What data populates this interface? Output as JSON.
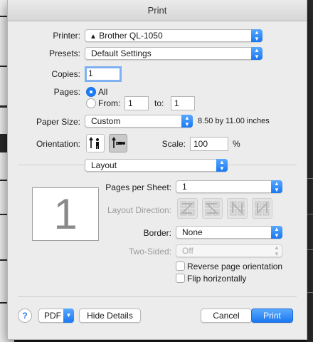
{
  "window": {
    "title": "Print"
  },
  "printer": {
    "label": "Printer:",
    "value": "Brother QL-1050",
    "warning_icon": "warning-triangle-icon"
  },
  "presets": {
    "label": "Presets:",
    "value": "Default Settings"
  },
  "copies": {
    "label": "Copies:",
    "value": "1"
  },
  "pages": {
    "label": "Pages:",
    "all_label": "All",
    "from_label": "From:",
    "from_value": "1",
    "to_label": "to:",
    "to_value": "1",
    "selected": "All"
  },
  "paper_size": {
    "label": "Paper Size:",
    "value": "Custom",
    "dimensions": "8.50 by 11.00 inches"
  },
  "orientation": {
    "label": "Orientation:",
    "selected": "landscape"
  },
  "scale": {
    "label": "Scale:",
    "value": "100",
    "unit": "%"
  },
  "section": {
    "value": "Layout"
  },
  "preview": {
    "page_number": "1"
  },
  "layout": {
    "pages_per_sheet_label": "Pages per Sheet:",
    "pages_per_sheet_value": "1",
    "layout_direction_label": "Layout Direction:",
    "border_label": "Border:",
    "border_value": "None",
    "two_sided_label": "Two-Sided:",
    "two_sided_value": "Off",
    "reverse_label": "Reverse page orientation",
    "reverse_checked": false,
    "flip_label": "Flip horizontally",
    "flip_checked": false
  },
  "footer": {
    "help_label": "?",
    "pdf_label": "PDF",
    "hide_details_label": "Hide Details",
    "cancel_label": "Cancel",
    "print_label": "Print"
  },
  "colors": {
    "accent": "#1b78f2",
    "dialog_bg": "#ececec"
  }
}
